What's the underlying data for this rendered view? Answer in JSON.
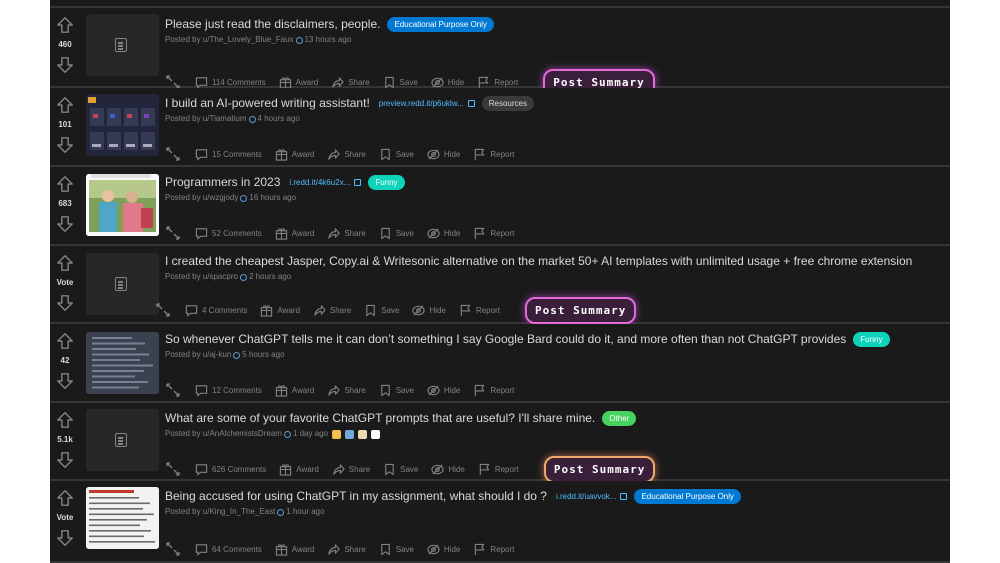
{
  "actions": {
    "comments_suffix": "Comments",
    "award": "Award",
    "share": "Share",
    "save": "Save",
    "hide": "Hide",
    "report": "Report",
    "post_summary": "Post Summary"
  },
  "posts": [
    {
      "score": "460",
      "title": "Please just read the disclaimers, people.",
      "link": "",
      "flair": "Educational Purpose Only",
      "flair_bg": "#0079d3",
      "flair_fg": "#ffffff",
      "author": "Posted by u/The_Lovely_Blue_Faux",
      "time": "13 hours ago",
      "comments": "114 Comments",
      "summary": true,
      "summary_style": "pink",
      "thumb": "text"
    },
    {
      "score": "101",
      "title": "I build an AI-powered writing assistant!",
      "link": "preview.redd.it/p6uklw...",
      "flair": "Resources",
      "flair_bg": "#3a3a3c",
      "flair_fg": "#d7dadc",
      "author": "Posted by u/Tiamatium",
      "time": "4 hours ago",
      "comments": "15 Comments",
      "summary": false,
      "thumb": "app"
    },
    {
      "score": "683",
      "title": "Programmers in 2023",
      "link": "i.redd.it/4k6u2x...",
      "flair": "Funny",
      "flair_bg": "#0dd3bb",
      "flair_fg": "#ffffff",
      "author": "Posted by u/wzgjody",
      "time": "16 hours ago",
      "comments": "52 Comments",
      "summary": false,
      "thumb": "photo"
    },
    {
      "score": "Vote",
      "title": "I created the cheapest Jasper, Copy.ai & Writesonic alternative on the market 50+ AI templates with unlimited usage + free chrome extension",
      "link": "",
      "flair": "",
      "author": "Posted by u/spacpro",
      "time": "2 hours ago",
      "comments": "4 Comments",
      "summary": true,
      "summary_style": "pink",
      "thumb": "text"
    },
    {
      "score": "42",
      "title": "So whenever ChatGPT tells me it can don’t something I say Google Bard could do it, and more often than not ChatGPT provides",
      "link": "",
      "flair": "Funny",
      "flair_bg": "#0dd3bb",
      "flair_fg": "#ffffff",
      "author": "Posted by u/aj-kun",
      "time": "5 hours ago",
      "comments": "12 Comments",
      "summary": false,
      "thumb": "screenshot"
    },
    {
      "score": "5.1k",
      "title": "What are some of your favorite ChatGPT prompts that are useful? I'll share mine.",
      "link": "",
      "flair": "Other",
      "flair_bg": "#46d160",
      "flair_fg": "#ffffff",
      "author": "Posted by u/AnAlchemistsDream",
      "time": "1 day ago",
      "comments": "626 Comments",
      "summary": true,
      "summary_style": "gold",
      "thumb": "text",
      "emojis": true
    },
    {
      "score": "Vote",
      "title": "Being accused for using ChatGPT in my assignment, what should I do ?",
      "link": "i.redd.it/uavvok...",
      "flair": "Educational Purpose Only",
      "flair_bg": "#0079d3",
      "flair_fg": "#ffffff",
      "author": "Posted by u/King_In_The_East",
      "time": "1 hour ago",
      "comments": "64 Comments",
      "summary": false,
      "thumb": "doc"
    }
  ],
  "colors": {
    "bg": "#1a1a1b",
    "text": "#d7dadc",
    "muted": "#818384",
    "link": "#4fbcff"
  },
  "icons": [
    "upvote-icon",
    "downvote-icon",
    "expand-icon",
    "comment-icon",
    "award-icon",
    "share-icon",
    "save-icon",
    "hide-icon",
    "report-icon"
  ]
}
